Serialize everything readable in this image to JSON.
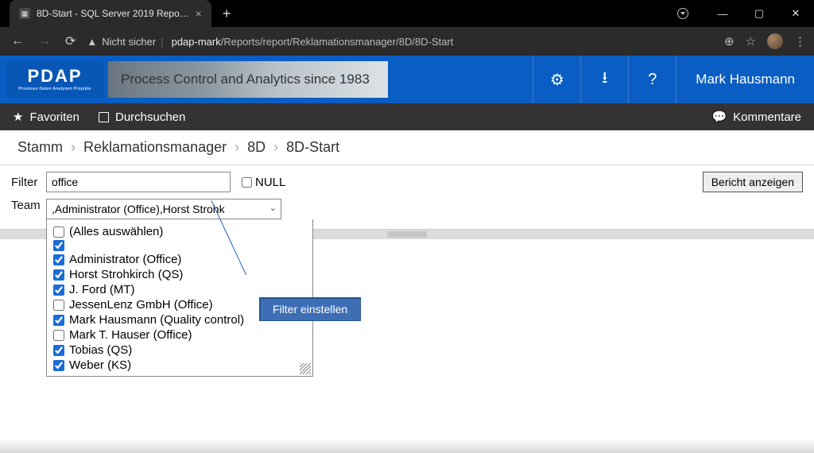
{
  "window": {
    "tab_title": "8D-Start - SQL Server 2019 Repo…",
    "insecure_label": "Nicht sicher",
    "url_host": "pdap-mark",
    "url_path": "/Reports/report/Reklamationsmanager/8D/8D-Start"
  },
  "brand": {
    "logo_text": "PDAP",
    "logo_sub": "Prozesse Daten Analysen Projekte",
    "banner_text": "Process Control and Analytics since 1983",
    "user": "Mark Hausmann"
  },
  "toolbar": {
    "favorites": "Favoriten",
    "browse": "Durchsuchen",
    "comments": "Kommentare"
  },
  "breadcrumbs": {
    "items": [
      "Stamm",
      "Reklamationsmanager",
      "8D",
      "8D-Start"
    ]
  },
  "params": {
    "filter_label": "Filter",
    "filter_value": "office",
    "null_label": "NULL",
    "team_label": "Team",
    "team_value": ",Administrator (Office),Horst Strohk",
    "run_label": "Bericht anzeigen",
    "options": [
      {
        "label": "(Alles auswählen)",
        "checked": false
      },
      {
        "label": "",
        "checked": true
      },
      {
        "label": "Administrator (Office)",
        "checked": true
      },
      {
        "label": "Horst Strohkirch (QS)",
        "checked": true
      },
      {
        "label": "J. Ford (MT)",
        "checked": true
      },
      {
        "label": "JessenLenz GmbH (Office)",
        "checked": false
      },
      {
        "label": "Mark Hausmann (Quality control)",
        "checked": true
      },
      {
        "label": "Mark T. Hauser (Office)",
        "checked": false
      },
      {
        "label": "Tobias (QS)",
        "checked": true
      },
      {
        "label": "Weber (KS)",
        "checked": true
      }
    ]
  },
  "callout": {
    "text": "Filter einstellen"
  }
}
